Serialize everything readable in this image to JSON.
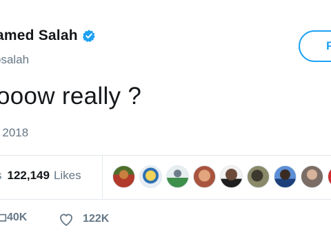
{
  "profile": {
    "name": "amed Salah",
    "handle": "osalah"
  },
  "follow_button": {
    "label": "F"
  },
  "tweet": {
    "text": "ooow really ?",
    "timestamp": "r 2018"
  },
  "stats": {
    "likes_prefix": "s",
    "likes_count": "122,149",
    "likes_label": "Likes"
  },
  "liker_avatars": [
    {
      "name": "avatar-1"
    },
    {
      "name": "avatar-2"
    },
    {
      "name": "avatar-3"
    },
    {
      "name": "avatar-4"
    },
    {
      "name": "avatar-5"
    },
    {
      "name": "avatar-6"
    },
    {
      "name": "avatar-7"
    },
    {
      "name": "avatar-8"
    },
    {
      "name": "avatar-9"
    }
  ],
  "actions": {
    "retweet_count": "40K",
    "like_count": "122K",
    "icons": [
      "reply-icon",
      "retweet-icon",
      "like-icon"
    ]
  },
  "colors": {
    "accent": "#1da1f2",
    "secondary_text": "#657786",
    "divider": "#e1e8ed"
  }
}
